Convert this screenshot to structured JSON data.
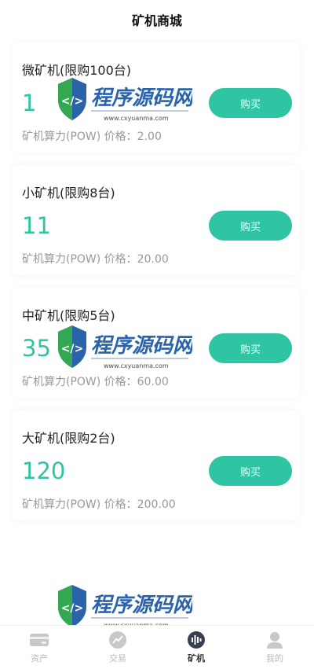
{
  "header": {
    "title": "矿机商城"
  },
  "products": [
    {
      "name": "微矿机(限购100台)",
      "power": "1",
      "price_text": "矿机算力(POW) 价格：2.00",
      "button": "购买"
    },
    {
      "name": "小矿机(限购8台)",
      "power": "11",
      "price_text": "矿机算力(POW) 价格：20.00",
      "button": "购买"
    },
    {
      "name": "中矿机(限购5台)",
      "power": "35",
      "price_text": "矿机算力(POW) 价格：60.00",
      "button": "购买"
    },
    {
      "name": "大矿机(限购2台)",
      "power": "120",
      "price_text": "矿机算力(POW) 价格：200.00",
      "button": "购买"
    }
  ],
  "tabbar": {
    "items": [
      {
        "label": "资产",
        "icon": "wallet-icon"
      },
      {
        "label": "交易",
        "icon": "trade-icon"
      },
      {
        "label": "矿机",
        "icon": "miner-icon",
        "active": true
      },
      {
        "label": "我的",
        "icon": "user-icon"
      }
    ]
  },
  "watermark": {
    "title": "程序源码网",
    "url": "www.cxyuanma.com"
  },
  "colors": {
    "accent": "#2ec4a4",
    "muted": "#999999"
  }
}
